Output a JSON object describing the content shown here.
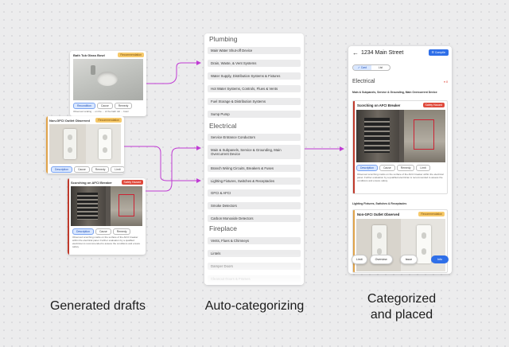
{
  "drafts": [
    {
      "title": "Bath Tub Glass Bowl",
      "badge": "Recommendation",
      "pills": [
        "Recondition",
        "Cause",
        "Remedy"
      ],
      "description": "Observed scaling ... on the ... of the bath tub ... bowl"
    },
    {
      "title": "Non-GFCI Outlet Observed",
      "badge": "Recommendation",
      "pills": [
        "Description",
        "Cause",
        "Remedy",
        "Limit"
      ]
    },
    {
      "title": "Scorching on AFCI Breaker",
      "badge": "Safety Hazard",
      "pills": [
        "Description",
        "Cause",
        "Remedy"
      ],
      "description": "Observed scorching marks on the surface of the AFCI breaker within the electrical panel. Further evaluation by a qualified electrician is recommended to assess the conditions and ensure safety."
    }
  ],
  "categories": {
    "groups": [
      {
        "heading": "Plumbing",
        "items": [
          "Main Water Shut-off Device",
          "Drain, Waste, & Vent Systems",
          "Water Supply, Distribution Systems & Fixtures",
          "Hot Water Systems, Controls, Flues & Vents",
          "Fuel Storage & Distribution Systems",
          "Sump Pump"
        ]
      },
      {
        "heading": "Electrical",
        "items": [
          "Service Entrance Conductors",
          "Main & Subpanels, Service & Grounding, Main Overcurrent Device",
          "Branch Wiring Circuits, Breakers & Fuses",
          "Lighting Fixtures, Switches & Receptacles",
          "GFCI & AFCI",
          "Smoke Detectors",
          "Carbon Monoxide Detectors"
        ]
      },
      {
        "heading": "Fireplace",
        "items": [
          "Vents, Flues & Chimneys",
          "Lintels",
          "Damper Doors",
          "Cleanout Doors & Frames"
        ]
      }
    ]
  },
  "phone": {
    "address": "1234 Main Street",
    "compile_label": "Compile",
    "toggle": [
      "Card",
      "List"
    ],
    "section": "Electrical",
    "section_count": "8",
    "subsection1": "Main & Subpanels, Service & Grounding, Main Overcurrent Device",
    "card1": {
      "title": "Scorching on AFCI Breaker",
      "badge": "Safety Hazard",
      "pills": [
        "Description",
        "Cause",
        "Remedy",
        "Limit"
      ],
      "description": "Observed scorching marks on the surface of the AFCI breaker within the electrical panel. Further evaluation by a qualified electrician is recommended to assess the conditions and ensure safety."
    },
    "subsection2": "Lighting Fixtures, Switches & Receptacles",
    "card2": {
      "title": "Non-GFCI Outlet Observed",
      "badge": "Recommendation"
    },
    "bottom_nav": [
      "Limit",
      "Overview",
      "Issue",
      "Info"
    ]
  },
  "labels": {
    "left": "Generated drafts",
    "middle": "Auto-categorizing",
    "right": "Categorized\nand placed"
  },
  "colors": {
    "accent": "#c03bd4",
    "brand": "#2f6fe8",
    "safety": "#e04a3c",
    "recommend": "#f6c96b"
  }
}
